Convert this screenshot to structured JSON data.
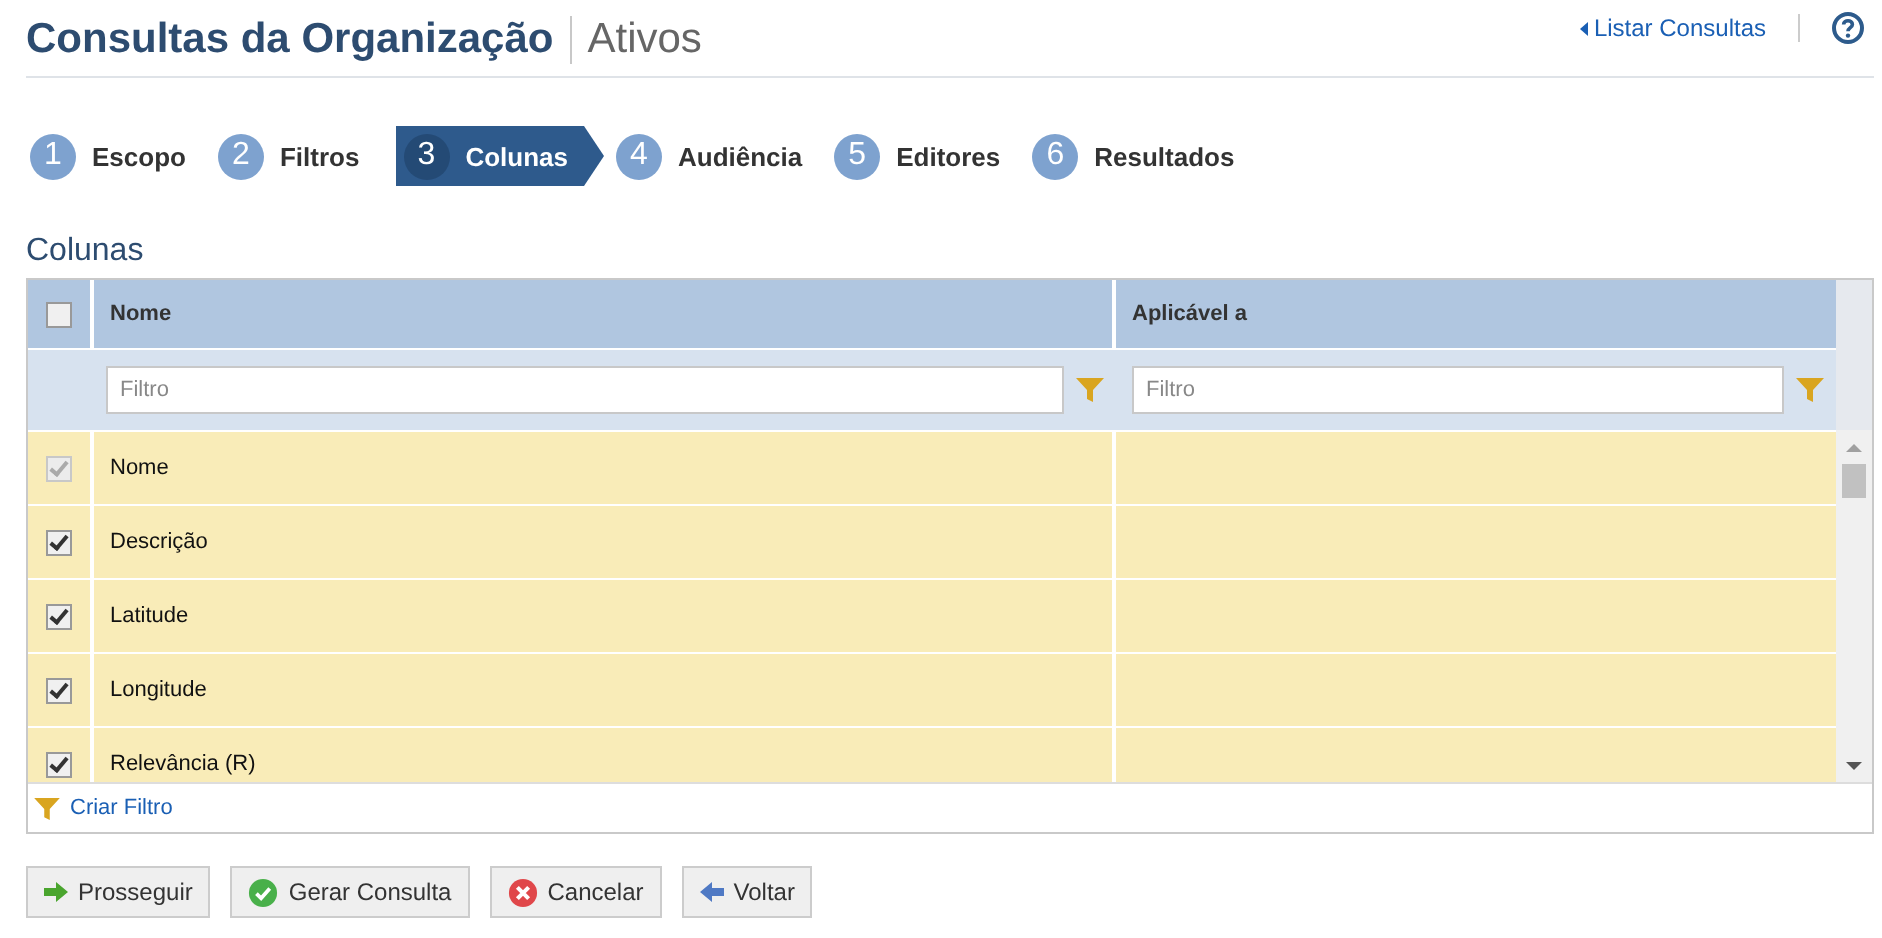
{
  "header": {
    "title": "Consultas da Organização",
    "subtitle": "Ativos",
    "link": "Listar Consultas"
  },
  "steps": [
    {
      "number": "1",
      "label": "Escopo",
      "selected": false
    },
    {
      "number": "2",
      "label": "Filtros",
      "selected": false
    },
    {
      "number": "3",
      "label": "Colunas",
      "selected": true
    },
    {
      "number": "4",
      "label": "Audiência",
      "selected": false
    },
    {
      "number": "5",
      "label": "Editores",
      "selected": false
    },
    {
      "number": "6",
      "label": "Resultados",
      "selected": false
    }
  ],
  "section_title": "Colunas",
  "table": {
    "select_all_checked": false,
    "columns": [
      "Nome",
      "Aplicável a"
    ],
    "filters": [
      {
        "placeholder": "Filtro"
      },
      {
        "placeholder": "Filtro"
      }
    ],
    "rows": [
      {
        "name": "Nome",
        "applies_to": "",
        "checked": true,
        "disabled": true
      },
      {
        "name": "Descrição",
        "applies_to": "",
        "checked": true,
        "disabled": false
      },
      {
        "name": "Latitude",
        "applies_to": "",
        "checked": true,
        "disabled": false
      },
      {
        "name": "Longitude",
        "applies_to": "",
        "checked": true,
        "disabled": false
      },
      {
        "name": "Relevância (R)",
        "applies_to": "",
        "checked": true,
        "disabled": false
      }
    ],
    "footer_link": "Criar Filtro"
  },
  "buttons": [
    {
      "kind": "next",
      "label": "Prosseguir"
    },
    {
      "kind": "generate",
      "label": "Gerar Consulta"
    },
    {
      "kind": "cancel",
      "label": "Cancelar"
    },
    {
      "kind": "back",
      "label": "Voltar"
    }
  ]
}
